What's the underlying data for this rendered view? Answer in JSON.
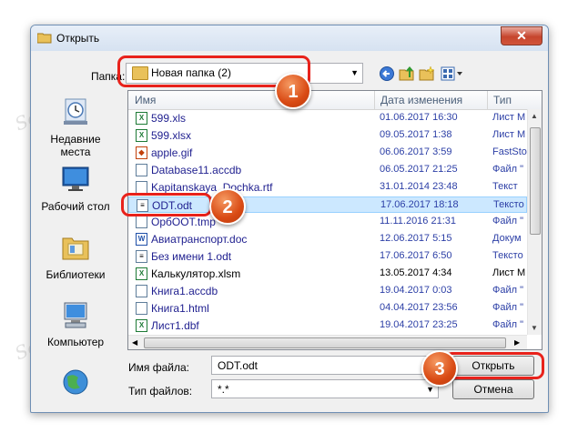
{
  "window": {
    "title": "Открыть",
    "close": "✕"
  },
  "folder": {
    "label": "Папка:",
    "current": "Новая папка (2)"
  },
  "places": [
    {
      "label": "Недавние места",
      "icon": "recent-places-icon"
    },
    {
      "label": "Рабочий стол",
      "icon": "desktop-icon"
    },
    {
      "label": "Библиотеки",
      "icon": "libraries-icon"
    },
    {
      "label": "Компьютер",
      "icon": "computer-icon"
    }
  ],
  "columns": {
    "name": "Имя",
    "date": "Дата изменения",
    "type": "Тип"
  },
  "files": [
    {
      "name": "599.xls",
      "date": "01.06.2017 16:30",
      "type": "Лист M",
      "icon": "excel-file-icon",
      "selected": false
    },
    {
      "name": "599.xlsx",
      "date": "09.05.2017 1:38",
      "type": "Лист M",
      "icon": "excel-file-icon",
      "selected": false
    },
    {
      "name": "apple.gif",
      "date": "06.06.2017 3:59",
      "type": "FastSto",
      "icon": "image-file-icon",
      "selected": false
    },
    {
      "name": "Database11.accdb",
      "date": "06.05.2017 21:25",
      "type": "Файл \"",
      "icon": "blank-file-icon",
      "selected": false
    },
    {
      "name": "Kapitanskaya_Dochka.rtf",
      "date": "31.01.2014 23:48",
      "type": "Текст",
      "icon": "blank-file-icon",
      "selected": false
    },
    {
      "name": "ODT.odt",
      "date": "17.06.2017 18:18",
      "type": "Тексто",
      "icon": "odt-file-icon",
      "selected": true
    },
    {
      "name": "ОрбООТ.tmp",
      "date": "11.11.2016 21:31",
      "type": "Файл \"",
      "icon": "blank-file-icon",
      "selected": false
    },
    {
      "name": "Авиатранспорт.doc",
      "date": "12.06.2017 5:15",
      "type": "Докум",
      "icon": "word-file-icon",
      "selected": false
    },
    {
      "name": "Без имени 1.odt",
      "date": "17.06.2017 6:50",
      "type": "Тексто",
      "icon": "odt-file-icon",
      "selected": false
    },
    {
      "name": "Калькулятор.xlsm",
      "date": "13.05.2017 4:34",
      "type": "Лист M",
      "icon": "excel-file-icon",
      "selected": false
    },
    {
      "name": "Книга1.accdb",
      "date": "19.04.2017 0:03",
      "type": "Файл \"",
      "icon": "blank-file-icon",
      "selected": false
    },
    {
      "name": "Книга1.html",
      "date": "04.04.2017 23:56",
      "type": "Файл \"",
      "icon": "blank-file-icon",
      "selected": false
    },
    {
      "name": "Лист1.dbf",
      "date": "19.04.2017 23:25",
      "type": "Файл \"",
      "icon": "excel-file-icon",
      "selected": false
    }
  ],
  "filename": {
    "label": "Имя файла:",
    "value": "ODT.odt"
  },
  "filetype": {
    "label": "Тип файлов:",
    "value": "*.*"
  },
  "buttons": {
    "open": "Открыть",
    "cancel": "Отмена"
  },
  "badges": [
    "1",
    "2",
    "3"
  ],
  "watermark": "Soringpcrepair.com",
  "colors": {
    "highlight": "#e8221b",
    "badge": "#d94a14",
    "selection": "#cce8ff"
  }
}
